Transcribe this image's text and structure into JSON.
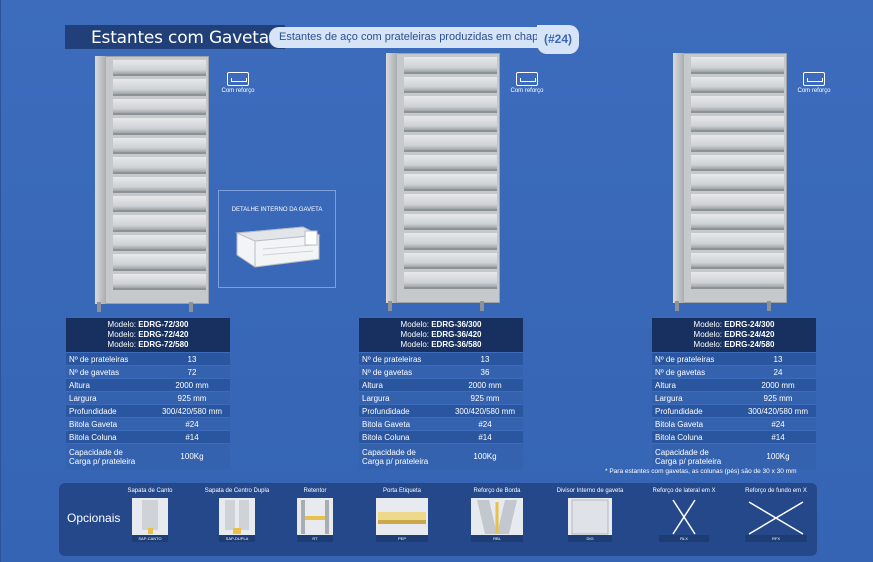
{
  "header": {
    "title": "Estantes com Gavetas",
    "subtitle": "Estantes de aço com prateleiras produzidas em chapa",
    "code": "(#24)"
  },
  "reinforce_label": "Com reforço",
  "detail_label": "DETALHE INTERNO DA GAVETA",
  "row_labels": {
    "shelves": "Nº de prateleiras",
    "drawers": "Nº de gavetas",
    "height": "Altura",
    "width": "Largura",
    "depth": "Profundidade",
    "drawer_gauge": "Bitola Gaveta",
    "column_gauge": "Bitola Coluna",
    "capacity_1": "Capacidade de",
    "capacity_2": "Carga p/ prateleira"
  },
  "models": [
    {
      "m1": "EDRG-72/300",
      "m2": "EDRG-72/420",
      "m3": "EDRG-72/580",
      "shelves": "13",
      "drawers": "72",
      "height": "2000 mm",
      "width": "925 mm",
      "depth": "300/420/580 mm",
      "drawer_gauge": "#24",
      "column_gauge": "#14",
      "capacity": "100Kg"
    },
    {
      "m1": "EDRG-36/300",
      "m2": "EDRG-36/420",
      "m3": "EDRG-36/580",
      "shelves": "13",
      "drawers": "36",
      "height": "2000 mm",
      "width": "925 mm",
      "depth": "300/420/580 mm",
      "drawer_gauge": "#24",
      "column_gauge": "#14",
      "capacity": "100Kg"
    },
    {
      "m1": "EDRG-24/300",
      "m2": "EDRG-24/420",
      "m3": "EDRG-24/580",
      "shelves": "13",
      "drawers": "24",
      "height": "2000 mm",
      "width": "925 mm",
      "depth": "300/420/580 mm",
      "drawer_gauge": "#24",
      "column_gauge": "#14",
      "capacity": "100Kg"
    }
  ],
  "model_prefix": "Modelo: ",
  "note": "* Para estantes com gavetas, as colunas (pés) são de 30 x 30 mm",
  "optionals": {
    "title": "Opcionais",
    "items": [
      {
        "label": "Sapata de Canto",
        "tag": "SAP-CANTO"
      },
      {
        "label": "Sapata de Centro Dupla",
        "tag": "SAP-DUPLA"
      },
      {
        "label": "Retentor",
        "tag": "RT"
      },
      {
        "label": "Porta Etiqueta",
        "tag": "PEP"
      },
      {
        "label": "Reforço de Borda",
        "tag": "RBL"
      },
      {
        "label": "Divisor Interno de gaveta",
        "tag": "DIG"
      },
      {
        "label": "Reforço de lateral em X",
        "tag": "RLX"
      },
      {
        "label": "Reforço de fundo em X",
        "tag": "RFX"
      }
    ]
  }
}
